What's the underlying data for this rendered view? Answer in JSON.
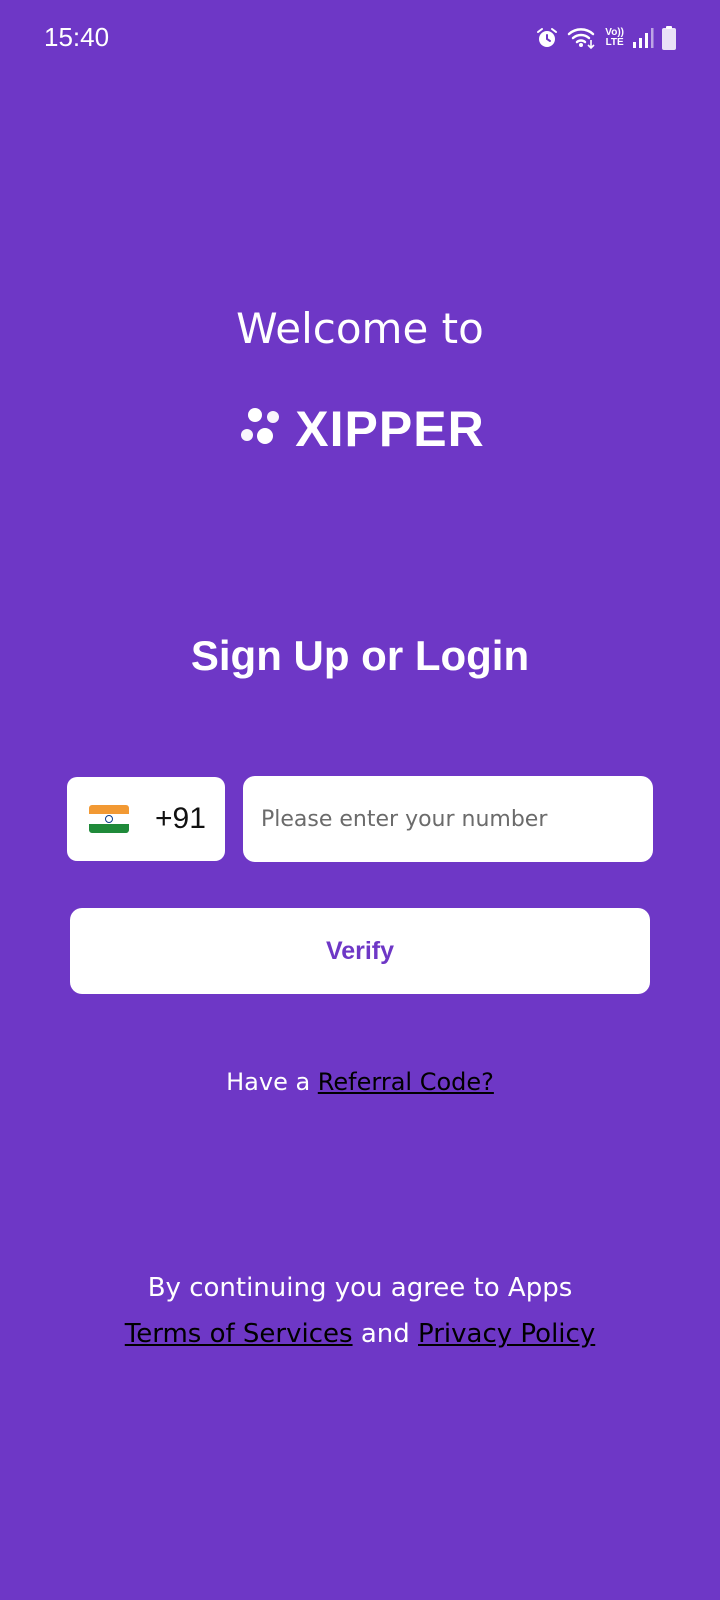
{
  "status_bar": {
    "time": "15:40",
    "volte_line1": "Vo))",
    "volte_line2": "LTE",
    "icons": [
      "alarm-icon",
      "wifi-icon",
      "volte-icon",
      "signal-icon",
      "battery-icon"
    ]
  },
  "welcome": {
    "heading": "Welcome to",
    "brand": "XIPPER"
  },
  "auth": {
    "title": "Sign Up or Login",
    "country_code": "+91",
    "country_flag": "india-flag-icon",
    "phone_placeholder": "Please enter your number",
    "phone_value": "",
    "verify_label": "Verify"
  },
  "referral": {
    "prefix": "Have a ",
    "link": "Referral Code?"
  },
  "legal": {
    "line1": "By continuing you agree to Apps",
    "terms": "Terms of Services",
    "and": " and ",
    "privacy": "Privacy Policy"
  },
  "colors": {
    "background": "#6e37c6",
    "accent": "#6e37c6",
    "text": "#ffffff",
    "link": "#000000"
  }
}
